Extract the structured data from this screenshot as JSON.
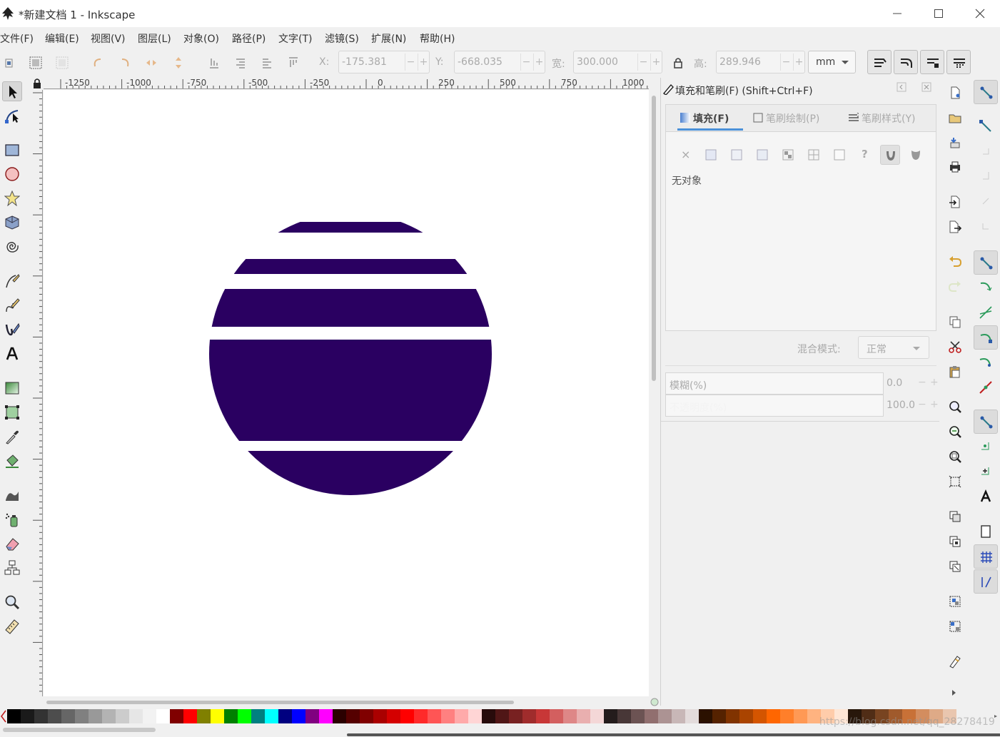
{
  "window": {
    "title": "*新建文档 1 - Inkscape",
    "controls": [
      "minimize",
      "maximize",
      "close"
    ]
  },
  "menu": [
    {
      "label": "文件(F)"
    },
    {
      "label": "编辑(E)"
    },
    {
      "label": "视图(V)"
    },
    {
      "label": "图层(L)"
    },
    {
      "label": "对象(O)"
    },
    {
      "label": "路径(P)"
    },
    {
      "label": "文字(T)"
    },
    {
      "label": "滤镜(S)"
    },
    {
      "label": "扩展(N)"
    },
    {
      "label": "帮助(H)"
    }
  ],
  "toolbar": {
    "x_label": "X:",
    "x_value": "-175.381",
    "y_label": "Y:",
    "y_value": "-668.035",
    "w_label": "宽:",
    "w_value": "300.000",
    "h_label": "高:",
    "h_value": "289.946",
    "unit": "mm",
    "minus": "−",
    "plus": "+"
  },
  "ruler": {
    "labels": [
      "-1250",
      "-1000",
      "-750",
      "-500",
      "-250",
      "0",
      "250",
      "500",
      "750",
      "1000"
    ]
  },
  "tools": [
    {
      "name": "selector-tool",
      "icon": "arrow-icon",
      "active": true
    },
    {
      "name": "node-tool",
      "icon": "node-icon"
    },
    {
      "name": "rect-tool",
      "icon": "rectangle-icon"
    },
    {
      "name": "ellipse-tool",
      "icon": "circle-icon"
    },
    {
      "name": "star-tool",
      "icon": "star-icon"
    },
    {
      "name": "3dbox-tool",
      "icon": "cube-icon"
    },
    {
      "name": "spiral-tool",
      "icon": "spiral-icon"
    },
    {
      "name": "bezier-tool",
      "icon": "pen-icon"
    },
    {
      "name": "pencil-tool",
      "icon": "pencil-icon"
    },
    {
      "name": "calligraphy-tool",
      "icon": "calligraphy-icon"
    },
    {
      "name": "text-tool",
      "icon": "text-icon"
    },
    {
      "name": "gradient-tool",
      "icon": "gradient-icon"
    },
    {
      "name": "mesh-tool",
      "icon": "mesh-icon"
    },
    {
      "name": "dropper-tool",
      "icon": "dropper-icon"
    },
    {
      "name": "paint-bucket-tool",
      "icon": "bucket-icon"
    },
    {
      "name": "tweak-tool",
      "icon": "tweak-icon"
    },
    {
      "name": "spray-tool",
      "icon": "spray-icon"
    },
    {
      "name": "eraser-tool",
      "icon": "eraser-icon"
    },
    {
      "name": "connector-tool",
      "icon": "connector-icon"
    },
    {
      "name": "zoom-tool",
      "icon": "zoom-icon"
    },
    {
      "name": "measure-tool",
      "icon": "ruler-icon"
    }
  ],
  "artwork": {
    "fill_color": "#2a0061"
  },
  "dock": {
    "title": "填充和笔刷(F) (Shift+Ctrl+F)",
    "tabs": [
      {
        "label": "填充(F)",
        "active": true
      },
      {
        "label": "笔刷绘制(P)"
      },
      {
        "label": "笔刷样式(Y)"
      }
    ],
    "paint_modes": [
      "none",
      "flat",
      "linear",
      "radial",
      "mesh",
      "pattern",
      "swatch",
      "unset",
      "evenodd",
      "nonzero"
    ],
    "paint_unknown_glyph": "?",
    "paint_none_glyph": "×",
    "no_object": "无对象",
    "blend_label": "混合模式:",
    "blend_value": "正常",
    "blur_label": "模糊(%)",
    "blur_value": "0.0",
    "opacity_label": "不透明度(%)",
    "opacity_value": "100.0"
  },
  "palette": {
    "colors": [
      "#000000",
      "#1a1a1a",
      "#333333",
      "#4d4d4d",
      "#666666",
      "#808080",
      "#999999",
      "#b3b3b3",
      "#cccccc",
      "#e6e6e6",
      "#f2f2f2",
      "#ffffff",
      "#800000",
      "#ff0000",
      "#808000",
      "#ffff00",
      "#008000",
      "#00ff00",
      "#008080",
      "#00ffff",
      "#000080",
      "#0000ff",
      "#800080",
      "#ff00ff",
      "#2b0000",
      "#550000",
      "#800000",
      "#aa0000",
      "#d40000",
      "#ff0000",
      "#ff2a2a",
      "#ff5555",
      "#ff8080",
      "#ffaaaa",
      "#ffd5d5",
      "#280b0b",
      "#501616",
      "#782121",
      "#a02c2c",
      "#c83737",
      "#d35f5f",
      "#de8787",
      "#e9afaf",
      "#f4d7d7",
      "#241c1c",
      "#483737",
      "#6c5353",
      "#916f6f",
      "#ac9393",
      "#c8b7b7",
      "#e3dbdb",
      "#2b1100",
      "#552200",
      "#803300",
      "#aa4400",
      "#d45500",
      "#ff6600",
      "#ff7f2a",
      "#ff9955",
      "#ffb380",
      "#ffccaa",
      "#ffe6d5",
      "#28170b",
      "#502d16",
      "#784421",
      "#a05a2c",
      "#c87137",
      "#d38d5f",
      "#deaa87",
      "#e9c6af"
    ]
  },
  "watermark": "https://blog.csdn.net/qq_28278419"
}
